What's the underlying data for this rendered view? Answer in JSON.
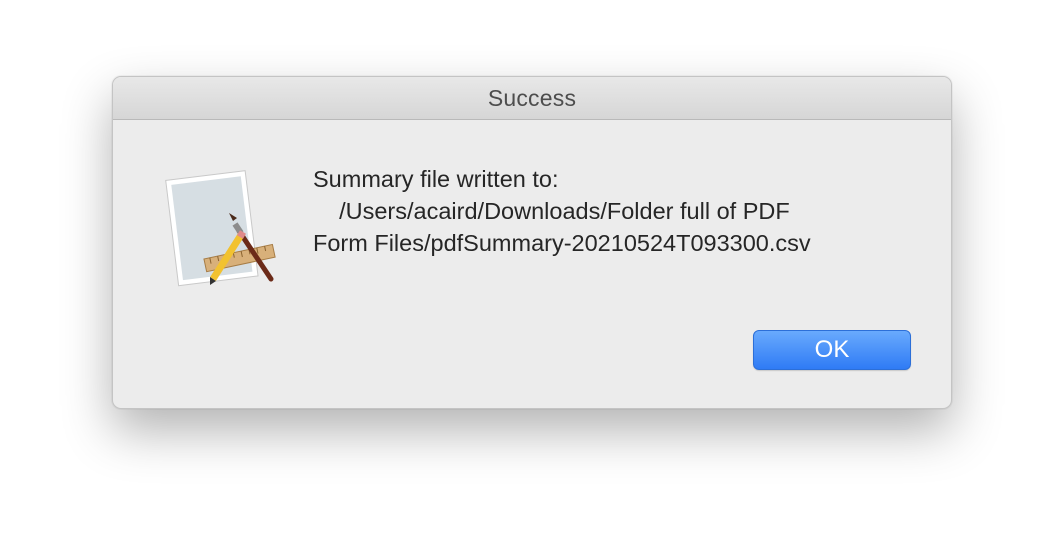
{
  "dialog": {
    "title": "Success",
    "message_lines": [
      "Summary file written to:",
      "    /Users/acaird/Downloads/Folder full of PDF",
      "Form Files/pdfSummary-20210524T093300.csv"
    ],
    "ok_label": "OK",
    "icon": "script-editor-app-icon"
  },
  "colors": {
    "accent": "#3b83f7",
    "dialog_background": "#ececec"
  }
}
